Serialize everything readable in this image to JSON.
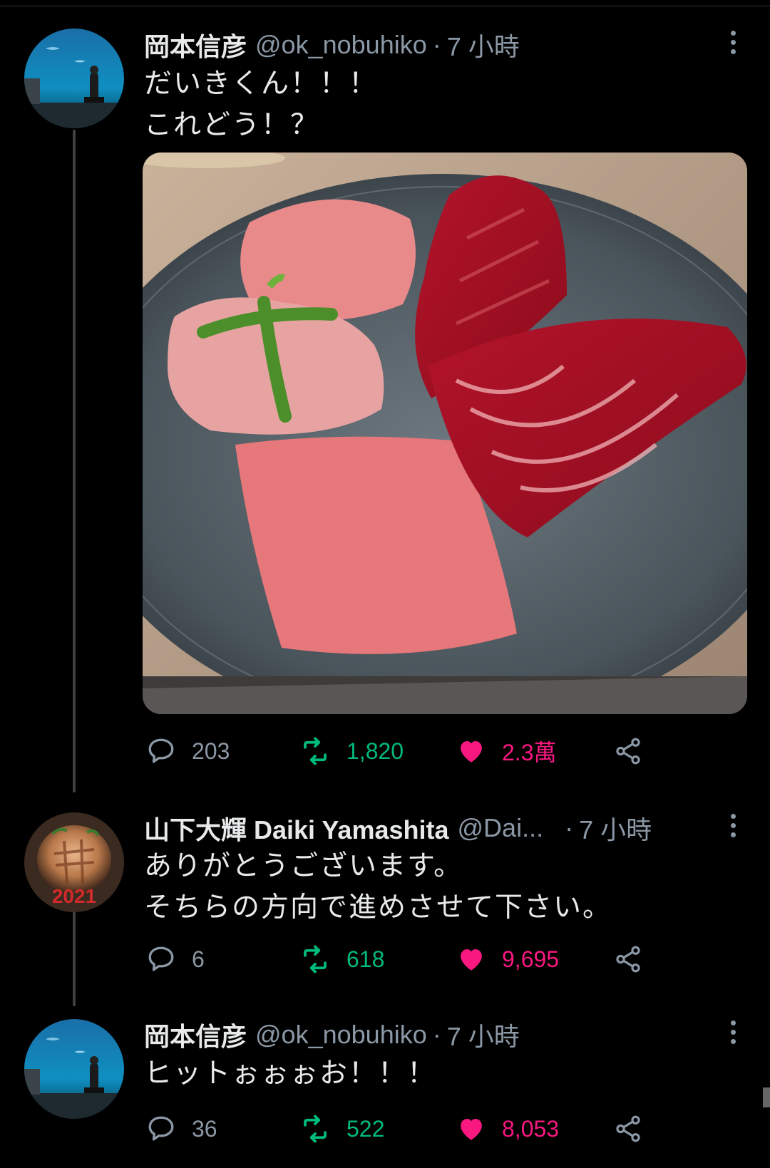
{
  "tweets": [
    {
      "name": "岡本信彦",
      "handle": "@ok_nobuhiko",
      "dot": "·",
      "time": "7 小時",
      "lines": [
        "だいきくん！！！",
        "これどう！？"
      ],
      "avatar": "aquarium-photo",
      "image": "wagyu-plate-photo",
      "replies": "203",
      "retweets": "1,820",
      "likes": "2.3萬"
    },
    {
      "name": "山下大輝 Daiki Yamashita",
      "handle": "@Dai...",
      "dot": "·",
      "time": "7 小時",
      "lines": [
        "ありがとうございます。",
        "そちらの方向で進めさせて下さい。"
      ],
      "avatar": "food-photo",
      "avatar_text": "2021",
      "replies": "6",
      "retweets": "618",
      "likes": "9,695"
    },
    {
      "name": "岡本信彦",
      "handle": "@ok_nobuhiko",
      "dot": "·",
      "time": "7 小時",
      "lines": [
        "ヒットぉぉぉお！！！"
      ],
      "avatar": "aquarium-photo",
      "replies": "36",
      "retweets": "522",
      "likes": "8,053"
    }
  ],
  "icons": {
    "reply": "speech-bubble-icon",
    "retweet": "retweet-icon",
    "like": "heart-filled-icon",
    "share": "share-icon",
    "more": "vertical-ellipsis-icon"
  },
  "colors": {
    "background": "#000000",
    "text": "#e7e9ea",
    "muted": "#8b98a5",
    "retweet": "#00ba7c",
    "like": "#f91880"
  }
}
